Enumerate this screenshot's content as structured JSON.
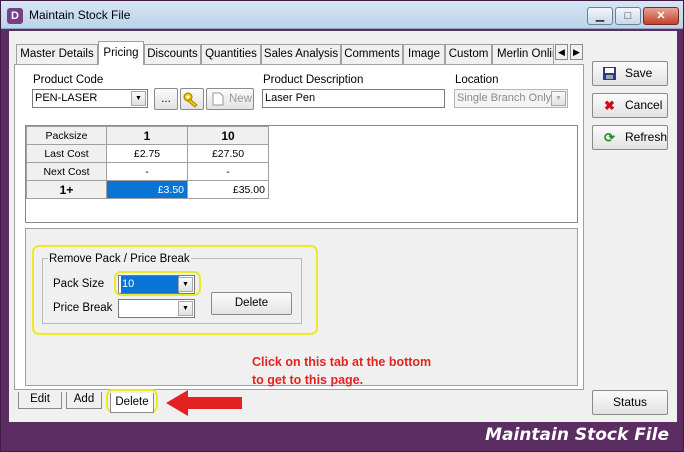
{
  "window": {
    "app_icon_letter": "D",
    "title": "Maintain Stock File",
    "minimize": "▁",
    "maximize": "□",
    "close": "✕",
    "footer_title": "Maintain Stock File"
  },
  "tabs": {
    "items": [
      "Master Details",
      "Pricing",
      "Discounts",
      "Quantities",
      "Sales Analysis",
      "Comments",
      "Image",
      "Custom",
      "Merlin Onlin"
    ],
    "active": "Pricing",
    "scroll_left": "◀",
    "scroll_right": "▶"
  },
  "product": {
    "code_label": "Product Code",
    "code_value": "PEN-LASER",
    "browse_label": "...",
    "key_icon": "key-icon",
    "new_label": "New",
    "description_label": "Product Description",
    "description_value": "Laser Pen",
    "location_label": "Location",
    "location_value": "Single Branch Only"
  },
  "price_grid": {
    "headers": [
      "Packsize",
      "1",
      "10"
    ],
    "rows": [
      {
        "label": "Last Cost",
        "values": [
          "£2.75",
          "£27.50"
        ]
      },
      {
        "label": "Next Cost",
        "values": [
          "-",
          "-"
        ]
      },
      {
        "label": "1+",
        "values": [
          "£3.50",
          "£35.00"
        ]
      }
    ],
    "selected_cell": "£3.50"
  },
  "remove_pack": {
    "title": "Remove Pack / Price Break",
    "pack_size_label": "Pack Size",
    "pack_size_value": "10",
    "price_break_label": "Price Break",
    "price_break_value": "",
    "delete_label": "Delete"
  },
  "bottom_tabs": {
    "edit": "Edit",
    "add": "Add",
    "delete": "Delete"
  },
  "side_buttons": {
    "save": "Save",
    "cancel": "Cancel",
    "refresh": "Refresh",
    "status": "Status"
  },
  "annotation": {
    "note": "Click on this tab at the bottom to get to this page.",
    "highlight_color": "#eaea28",
    "arrow_color": "#e52222"
  }
}
